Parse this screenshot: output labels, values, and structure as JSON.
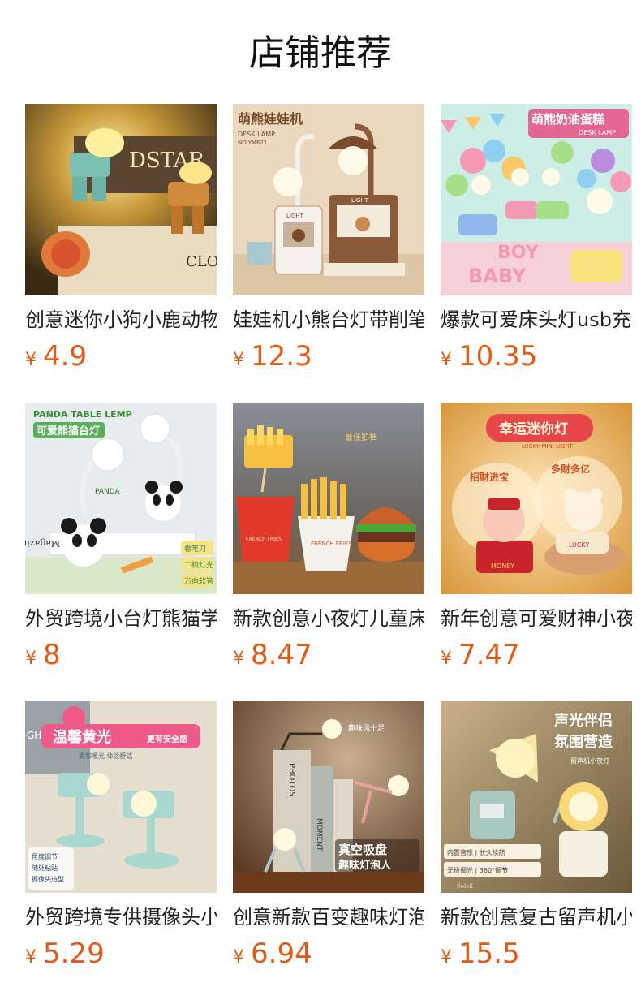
{
  "header": {
    "title": "店铺推荐"
  },
  "currency_symbol": "¥",
  "products": [
    {
      "name": "创意迷你小狗小鹿动物台灯",
      "price": "4.9",
      "icon": "deer-dog-lamp-image",
      "image_text": [
        "DSTAR",
        "CLOTH"
      ]
    },
    {
      "name": "娃娃机小熊台灯带削笔刀",
      "price": "12.3",
      "icon": "claw-machine-lamp-image",
      "image_text": [
        "萌熊娃娃机",
        "DESK LAMP",
        "NO.YM621",
        "LIGHT",
        "LIGHT"
      ]
    },
    {
      "name": "爆款可爱床头灯usb充电",
      "price": "10.35",
      "icon": "cake-lamp-image",
      "image_text": [
        "萌熊奶油蛋糕",
        "DESK LAMP",
        "BOY",
        "BABY"
      ]
    },
    {
      "name": "外贸跨境小台灯熊猫学生",
      "price": "8",
      "icon": "panda-lamp-image",
      "image_text": [
        "PANDA TABLE LEMP",
        "可爱熊猫台灯",
        "PANDA",
        "Fashion Magazine",
        "卷笔刀",
        "二档灯光",
        "万向软管"
      ]
    },
    {
      "name": "新款创意小夜灯儿童床头",
      "price": "8.47",
      "icon": "fries-burger-lamp-image",
      "image_text": [
        "最佳拍档",
        "FRENCH FRIES",
        "FRENCH FRIES"
      ]
    },
    {
      "name": "新年创意可爱财神小夜灯",
      "price": "7.47",
      "icon": "lucky-lamp-image",
      "image_text": [
        "幸运迷你灯",
        "LUCKY MINI LIGHT",
        "招财进宝",
        "多财多亿",
        "MONEY",
        "LUCKY"
      ]
    },
    {
      "name": "外贸跨境专供摄像头小夜灯",
      "price": "5.29",
      "icon": "camera-lamp-image",
      "image_text": [
        "GHTI",
        "温馨黄光",
        "更有安全感",
        "柔和暖光 体验舒适",
        "角度调节",
        "随处粘贴",
        "摄像头造型"
      ]
    },
    {
      "name": "创意新款百变趣味灯泡人",
      "price": "6.94",
      "icon": "bulb-man-lamp-image",
      "image_text": [
        "趣味风十足",
        "PHOTOS",
        "MOMENT",
        "真空吸盘",
        "趣味灯泡人"
      ]
    },
    {
      "name": "新款创意复古留声机小夜灯",
      "price": "15.5",
      "icon": "gramophone-lamp-image",
      "image_text": [
        "声光伴侣",
        "氛围营造",
        "留声机小夜灯",
        "内置音乐 | 长久续航",
        "无极调光 | 360°调节",
        "Soleil"
      ]
    }
  ]
}
